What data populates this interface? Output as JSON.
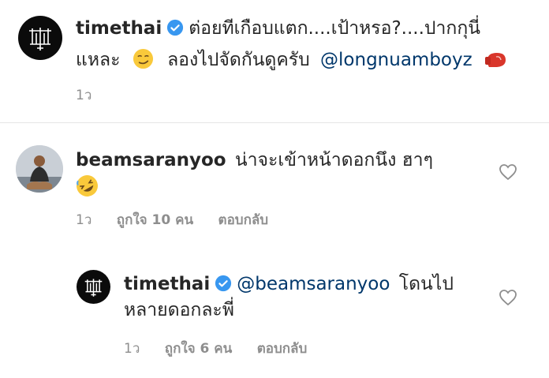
{
  "caption": {
    "username": "timethai",
    "text_line1": "ต่อยทีเกือบแตก....เป้าหรอ?....ปากกุนี่",
    "text_line2_a": "แหละ",
    "text_line2_b": "ลองไปจัดกันดูครับ",
    "mention": "@longnuamboyz",
    "time": "1ว"
  },
  "comment": {
    "username": "beamsaranyoo",
    "text": "น่าจะเข้าหน้าดอกนึง ฮาๆ",
    "time": "1ว",
    "likes": "ถูกใจ 10 คน",
    "reply": "ตอบกลับ"
  },
  "reply": {
    "username": "timethai",
    "mention": "@beamsaranyoo",
    "text_line1": "โดนไป",
    "text_line2": "หลายดอกละพี่",
    "time": "1ว",
    "likes": "ถูกใจ 6 คน",
    "reply": "ตอบกลับ"
  },
  "colors": {
    "text": "#262626",
    "meta": "#8e8e8e",
    "mention": "#00376b",
    "verified": "#3897f0",
    "divider": "#e6e6e6"
  },
  "icons": [
    "verified-badge-icon",
    "heart-icon",
    "smirk-emoji",
    "rofl-emoji",
    "boxing-glove-emoji"
  ]
}
